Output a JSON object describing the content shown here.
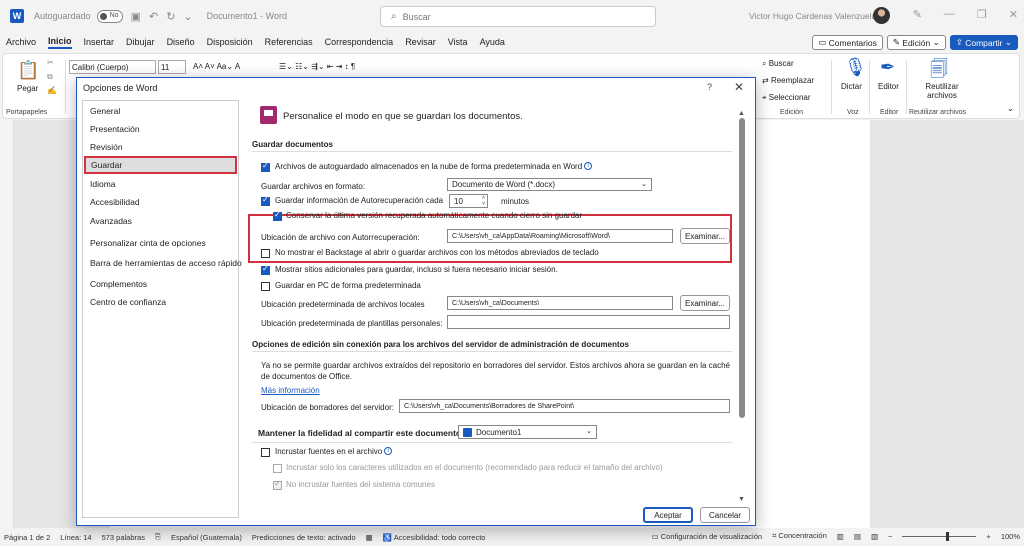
{
  "titlebar": {
    "autosave_label": "Autoguardado",
    "toggle_state": "No",
    "doc_title": "Documento1 - Word",
    "search_placeholder": "Buscar",
    "user_name": "Victor Hugo Cardenas Valenzuela"
  },
  "menubar": {
    "items": [
      "Archivo",
      "Inicio",
      "Insertar",
      "Dibujar",
      "Diseño",
      "Disposición",
      "Referencias",
      "Correspondencia",
      "Revisar",
      "Vista",
      "Ayuda"
    ],
    "comments": "Comentarios",
    "editing": "Edición",
    "share": "Compartir"
  },
  "ribbon": {
    "paste": "Pegar",
    "clipboard": "Portapapeles",
    "font_name": "Calibri (Cuerpo)",
    "font_size": "11",
    "find": "Buscar",
    "replace": "Reemplazar",
    "select": "Seleccionar",
    "editing_group": "Edición",
    "dictate": "Dictar",
    "voice_group": "Voz",
    "editor": "Editor",
    "editor_group": "Editor",
    "reuse": "Reutilizar archivos",
    "reuse_group": "Reutilizar archivos"
  },
  "dialog": {
    "title": "Opciones de Word",
    "help": "?",
    "nav": [
      "General",
      "Presentación",
      "Revisión",
      "Guardar",
      "Idioma",
      "Accesibilidad",
      "Avanzadas",
      "Personalizar cinta de opciones",
      "Barra de herramientas de acceso rápido",
      "Complementos",
      "Centro de confianza"
    ],
    "header": "Personalice el modo en que se guardan los documentos.",
    "save_section": "Guardar documentos",
    "cloud_autosave": "Archivos de autoguardado almacenados en la nube de forma predeterminada en Word",
    "save_format_label": "Guardar archivos en formato:",
    "save_format_value": "Documento de Word (*.docx)",
    "autorecover_label": "Guardar información de Autorecuperación cada",
    "autorecover_minutes": "10",
    "minutes_label": "minutos",
    "keep_last": "Conservar la última versión recuperada automáticamente cuando cierro sin guardar",
    "autorecover_location_label": "Ubicación de archivo con Autorrecuperación:",
    "autorecover_location": "C:\\Users\\vh_ca\\AppData\\Roaming\\Microsoft\\Word\\",
    "browse": "Examinar...",
    "no_backstage": "No mostrar el Backstage al abrir o guardar archivos con los métodos abreviados de teclado",
    "show_places": "Mostrar sitios adicionales para guardar, incluso si fuera necesario iniciar sesión.",
    "save_pc": "Guardar en PC de forma predeterminada",
    "local_location_label": "Ubicación predeterminada de archivos locales",
    "local_location": "C:\\Users\\vh_ca\\Documents\\",
    "templates_label": "Ubicación predeterminada de plantillas personales:",
    "templates_value": "",
    "offline_section": "Opciones de edición sin conexión para los archivos del servidor de administración de documentos",
    "offline_text_1": "Ya no se permite guardar archivos extraídos del repositorio en borradores del servidor. Estos archivos ahora se guardan en la caché",
    "offline_text_2": "de documentos de Office.",
    "more_info": "Más información",
    "drafts_label": "Ubicación de borradores del servidor:",
    "drafts_value": "C:\\Users\\vh_ca\\Documents\\Borradores de SharePoint\\",
    "fidelity_label": "Mantener la fidelidad al compartir este documento:",
    "fidelity_doc": "Documento1",
    "embed_fonts": "Incrustar fuentes en el archivo",
    "embed_used": "Incrustar solo los caracteres utilizados en el documento (recomendado para reducir el tamaño del archivo)",
    "no_common": "No incrustar fuentes del sistema comunes",
    "ok": "Aceptar",
    "cancel": "Cancelar"
  },
  "statusbar": {
    "page": "Página 1 de 2",
    "line": "Línea: 14",
    "words": "573 palabras",
    "language": "Español (Guatemala)",
    "predictions": "Predicciones de texto: activado",
    "accessibility": "Accesibilidad: todo correcto",
    "display_settings": "Configuración de visualización",
    "focus": "Concentración",
    "zoom": "100%"
  },
  "colors": {
    "accent": "#185abd",
    "highlight": "#d0313d"
  }
}
